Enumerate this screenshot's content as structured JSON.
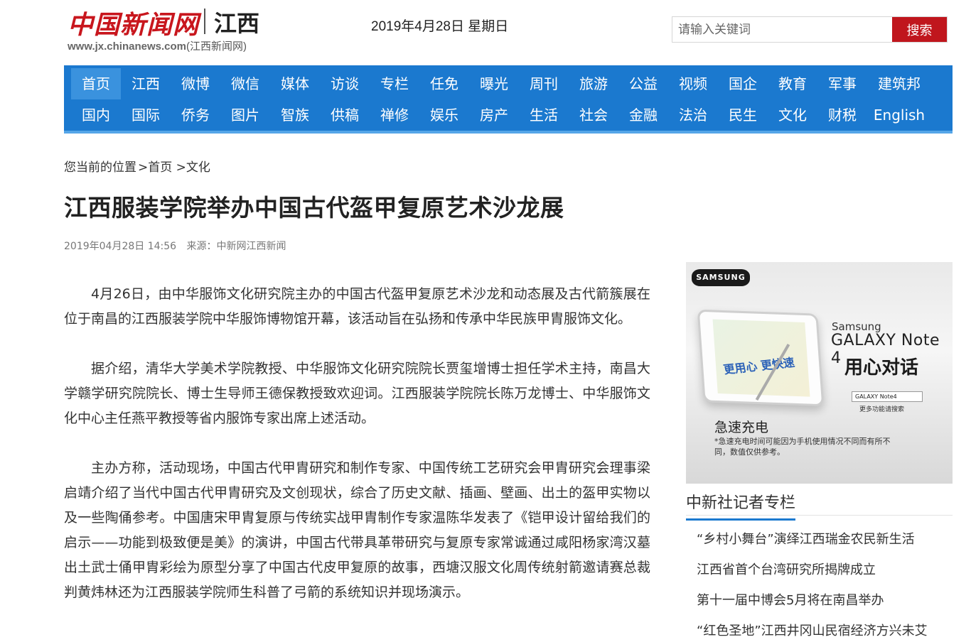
{
  "header": {
    "logo_cn": "中国新闻网",
    "logo_region": "江西",
    "logo_url": "www.jx.chinanews.com",
    "logo_url_suffix": "(江西新闻网)",
    "date": "2019年4月28日 星期日",
    "search": {
      "placeholder": "请输入关键词",
      "button_label": "搜索"
    }
  },
  "nav": {
    "row1": [
      "首页",
      "江西",
      "微博",
      "微信",
      "媒体",
      "访谈",
      "专栏",
      "任免",
      "曝光",
      "周刊",
      "旅游",
      "公益",
      "视频",
      "国企",
      "教育",
      "军事",
      "建筑邦"
    ],
    "row2": [
      "国内",
      "国际",
      "侨务",
      "图片",
      "智族",
      "供稿",
      "禅修",
      "娱乐",
      "房产",
      "生活",
      "社会",
      "金融",
      "法治",
      "民生",
      "文化",
      "财税",
      "English"
    ],
    "active": "首页"
  },
  "breadcrumb": {
    "prefix": "您当前的位置",
    "items": [
      ">首页",
      ">文化"
    ]
  },
  "article": {
    "title": "江西服装学院举办中国古代盔甲复原艺术沙龙展",
    "datetime": "2019年04月28日 14:56",
    "source": "来源：中新网江西新闻",
    "paragraphs": [
      "4月26日，由中华服饰文化研究院主办的中国古代盔甲复原艺术沙龙和动态展及古代箭簇展在位于南昌的江西服装学院中华服饰博物馆开幕，该活动旨在弘扬和传承中华民族甲胄服饰文化。",
      "据介绍，清华大学美术学院教授、中华服饰文化研究院院长贾玺增博士担任学术主持，南昌大学赣学研究院院长、博士生导师王德保教授致欢迎词。江西服装学院院长陈万龙博士、中华服饰文化中心主任燕平教授等省内服饰专家出席上述活动。",
      "主办方称，活动现场，中国古代甲胄研究和制作专家、中国传统工艺研究会甲胄研究会理事梁启靖介绍了当代中国古代甲胄研究及文创现状，综合了历史文献、插画、壁画、出土的盔甲实物以及一些陶俑参考。中国唐宋甲胄复原与传统实战甲胄制作专家温陈华发表了《铠甲设计留给我们的启示——功能到极致便是美》的演讲，中国古代带具革带研究与复原专家常诚通过咸阳杨家湾汉墓出土武士俑甲胄彩绘为原型分享了中国古代皮甲复原的故事，西塘汉服文化周传统射箭邀请赛总裁判黄炜林还为江西服装学院师生科普了弓箭的系统知识并现场演示。"
    ]
  },
  "ad": {
    "brand": "SAMSUNG",
    "model_line1": "Samsung",
    "model_line2": "GALAXY Note 4",
    "slogan": "用心对话",
    "screen_text": "更用心 更快速",
    "search_text": "GALAXY Note4",
    "more": "更多功能请搜索",
    "charge_title": "急速充电",
    "note": "*急速充电时间可能因为手机使用情况不同而有所不同，数值仅供参考。"
  },
  "sidebar": {
    "column_title": "中新社记者专栏",
    "items": [
      "“乡村小舞台”演绎江西瑞金农民新生活",
      "江西省首个台湾研究所揭牌成立",
      "第十一届中博会5月将在南昌举办",
      "“红色圣地”江西井冈山民宿经济方兴未艾"
    ]
  }
}
